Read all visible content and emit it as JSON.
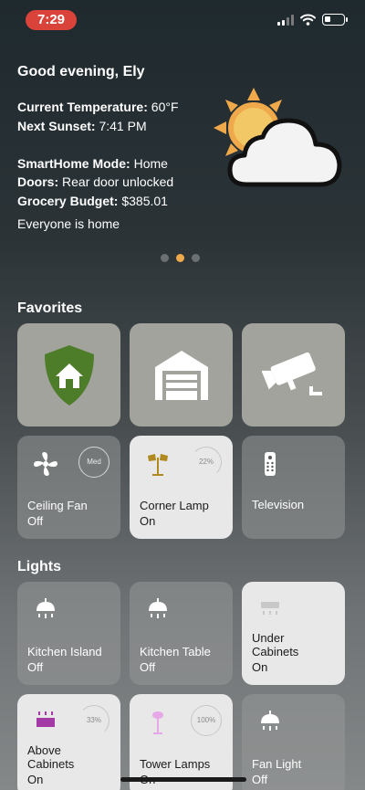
{
  "status": {
    "time": "7:29"
  },
  "summary": {
    "greeting": "Good evening, Ely",
    "temperature_label": "Current Temperature:",
    "temperature_value": "60°F",
    "sunset_label": "Next Sunset:",
    "sunset_value": "7:41 PM",
    "mode_label": "SmartHome Mode:",
    "mode_value": "Home",
    "doors_label": "Doors:",
    "doors_value": "Rear door unlocked",
    "budget_label": "Grocery Budget:",
    "budget_value": "$385.01",
    "presence": "Everyone is home",
    "weather_icon": "partly-cloudy-icon"
  },
  "pager": {
    "count": 3,
    "active": 1
  },
  "favorites": {
    "title": "Favorites",
    "quick": [
      {
        "name": "security-shield-icon"
      },
      {
        "name": "garage-icon"
      },
      {
        "name": "camera-icon"
      }
    ],
    "devices": [
      {
        "label": "Ceiling Fan",
        "state": "Off",
        "ring": "Med",
        "icon": "fan-icon"
      },
      {
        "label": "Corner Lamp",
        "state": "On",
        "ring": "22%",
        "icon": "lamp-icon"
      },
      {
        "label": "Television",
        "state": "",
        "ring": "",
        "icon": "remote-icon"
      }
    ]
  },
  "lights": {
    "title": "Lights",
    "items": [
      {
        "label": "Kitchen Island",
        "state": "Off"
      },
      {
        "label": "Kitchen Table",
        "state": "Off"
      },
      {
        "label": "Under Cabinets",
        "state": "On"
      },
      {
        "label": "Above Cabinets",
        "state": "On",
        "ring": "33%"
      },
      {
        "label": "Tower Lamps",
        "state": "On",
        "ring": "100%"
      },
      {
        "label": "Fan Light",
        "state": "Off"
      }
    ]
  },
  "colors": {
    "accent": "#f0a94a",
    "time_pill": "#d9433a",
    "shield": "#4e7d2a"
  }
}
